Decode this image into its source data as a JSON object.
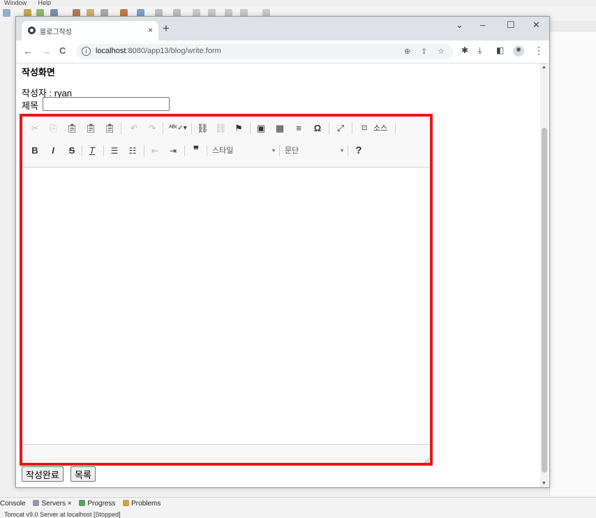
{
  "eclipse": {
    "menu": [
      "Window",
      "Help"
    ],
    "bottom_tabs": [
      "Console",
      "Servers",
      "Progress",
      "Problems"
    ],
    "server_status": "Tomcat v9.0 Server at localhost  [Stopped]"
  },
  "browser": {
    "tab_title": "블로그작성",
    "tab_close": "×",
    "new_tab": "+",
    "window_controls": [
      "⌄",
      "–",
      "☐",
      "✕"
    ],
    "back": "←",
    "forward": "→",
    "reload": "C",
    "url_host": "localhost",
    "url_path": ":8080/app13/blog/write.form",
    "menu": "⋮"
  },
  "page": {
    "heading": "작성화면",
    "author_line": "작성자 : ryan",
    "title_label": "제목",
    "title_value": ""
  },
  "editor": {
    "style_combo": "스타일",
    "format_combo": "문단",
    "source_label": "소스"
  },
  "buttons": {
    "submit": "작성완료",
    "list": "목록"
  },
  "colors": {
    "highlight": "#e41818",
    "chrome_tabstrip": "#dee1e6"
  }
}
